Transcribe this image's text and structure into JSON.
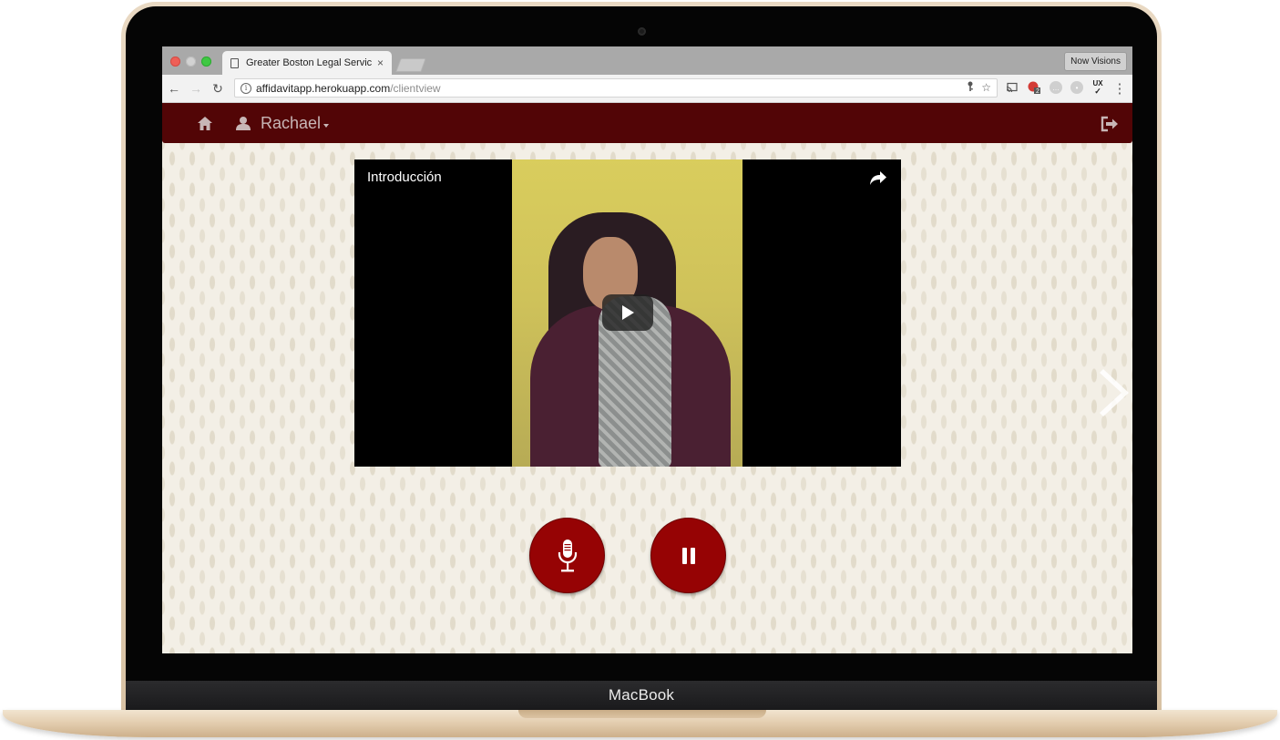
{
  "device": {
    "brand": "MacBook"
  },
  "browser": {
    "tab": {
      "title": "Greater Boston Legal Services",
      "close_glyph": "×"
    },
    "profile_label": "Now Visions",
    "url": {
      "host": "affidavitapp.herokuapp.com",
      "path": "/clientview"
    },
    "nav_glyphs": {
      "back": "←",
      "forward": "→",
      "reload": "↻",
      "info": "i",
      "more": "⋮",
      "bookmark_star": "☆"
    },
    "extensions": [
      {
        "icon": "cast-icon"
      },
      {
        "icon": "extension-badge-icon",
        "badge": "2"
      },
      {
        "icon": "extension-chat-icon"
      },
      {
        "icon": "extension-generic-icon"
      },
      {
        "icon": "ux-check-icon",
        "label": "UX"
      }
    ]
  },
  "app": {
    "nav": {
      "user_name": "Rachael",
      "home_icon": "home-icon",
      "user_icon": "user-icon",
      "logout_icon": "logout-icon"
    },
    "video": {
      "title": "Introducción",
      "share_icon": "share-icon",
      "play_icon": "play-icon"
    },
    "controls": [
      {
        "name": "microphone",
        "icon": "microphone-icon"
      },
      {
        "name": "pause",
        "icon": "pause-icon"
      }
    ],
    "next_icon": "chevron-right-icon"
  },
  "colors": {
    "navbar": "#520506",
    "control_buttons": "#960304",
    "background": "#f3efe6",
    "laptop_gold": "#e9d9c3"
  }
}
